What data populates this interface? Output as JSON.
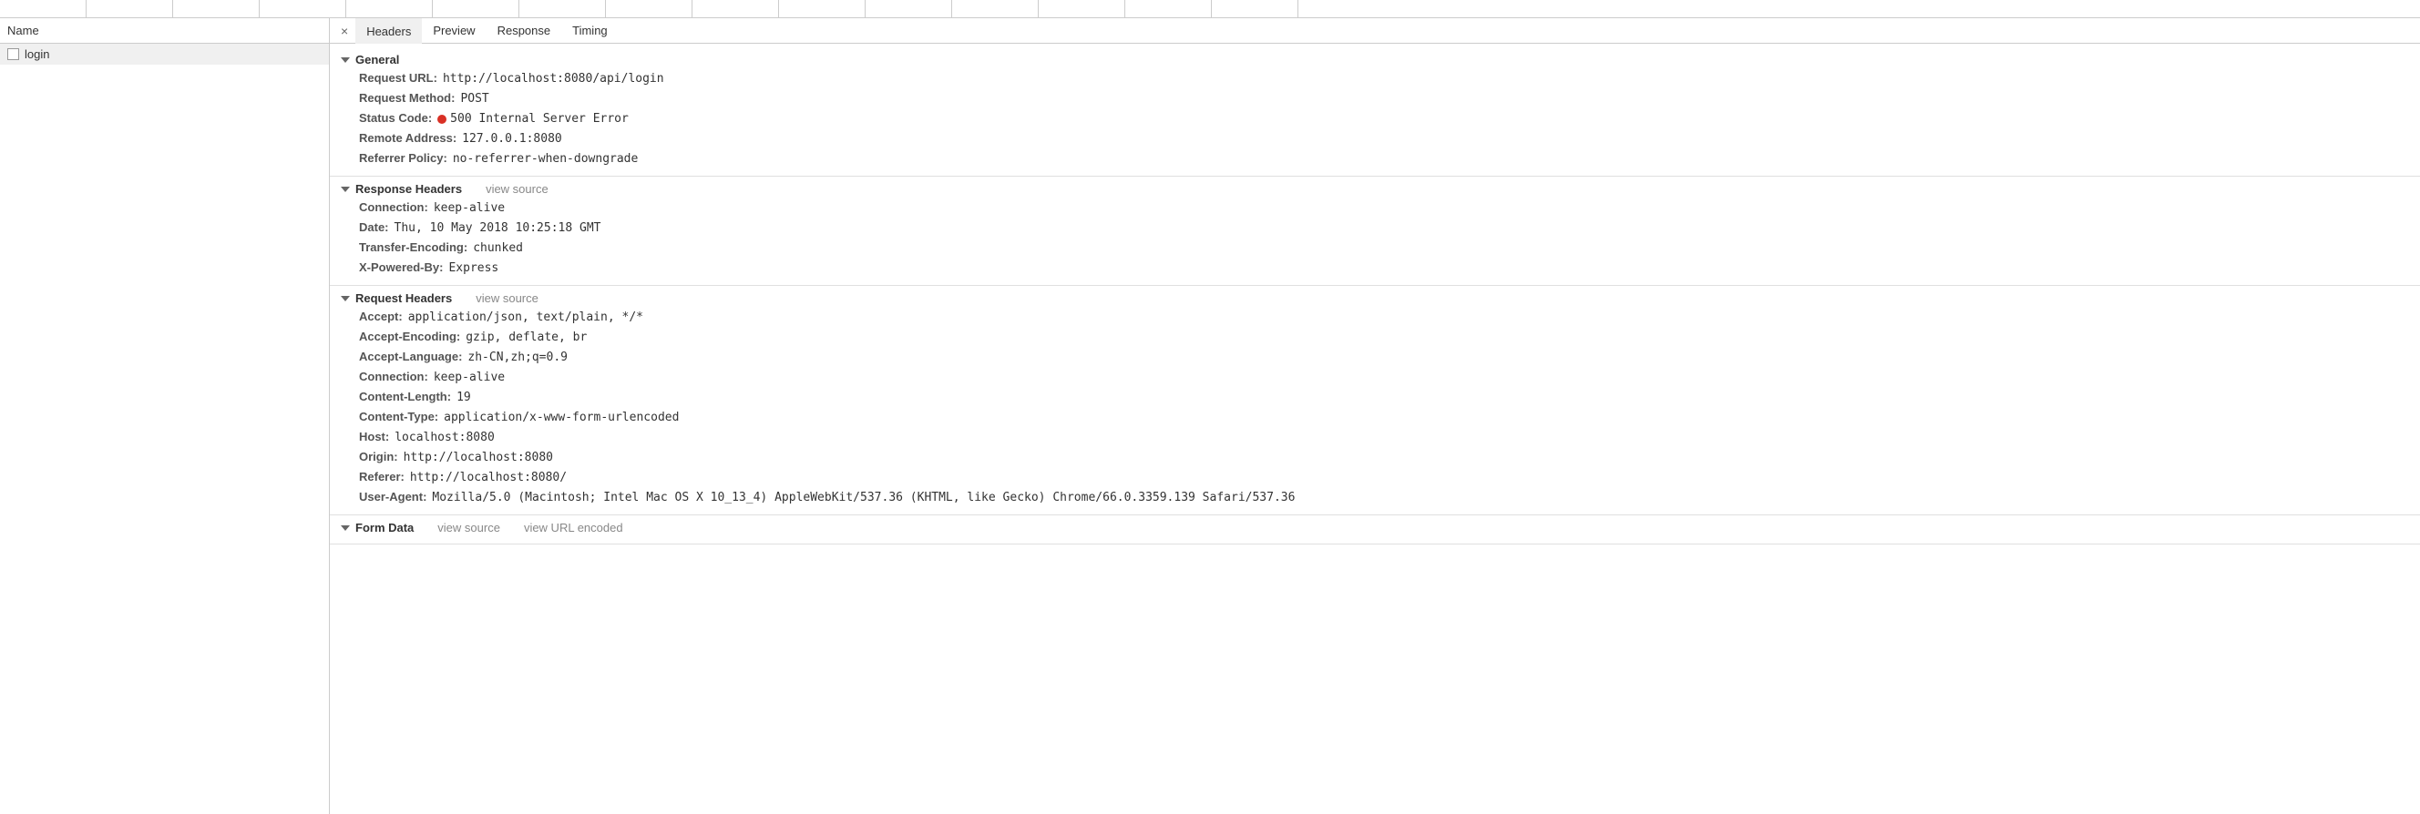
{
  "leftPanel": {
    "header": "Name",
    "requests": [
      {
        "name": "login"
      }
    ]
  },
  "detailTabs": {
    "close": "×",
    "headers": "Headers",
    "preview": "Preview",
    "response": "Response",
    "timing": "Timing"
  },
  "links": {
    "viewSource": "view source",
    "viewUrlEncoded": "view URL encoded"
  },
  "sections": {
    "general": {
      "title": "General",
      "requestUrlLabel": "Request URL:",
      "requestUrlValue": "http://localhost:8080/api/login",
      "requestMethodLabel": "Request Method:",
      "requestMethodValue": "POST",
      "statusCodeLabel": "Status Code:",
      "statusCodeValue": "500 Internal Server Error",
      "remoteAddressLabel": "Remote Address:",
      "remoteAddressValue": "127.0.0.1:8080",
      "referrerPolicyLabel": "Referrer Policy:",
      "referrerPolicyValue": "no-referrer-when-downgrade"
    },
    "responseHeaders": {
      "title": "Response Headers",
      "connectionLabel": "Connection:",
      "connectionValue": "keep-alive",
      "dateLabel": "Date:",
      "dateValue": "Thu, 10 May 2018 10:25:18 GMT",
      "transferEncodingLabel": "Transfer-Encoding:",
      "transferEncodingValue": "chunked",
      "xPoweredByLabel": "X-Powered-By:",
      "xPoweredByValue": "Express"
    },
    "requestHeaders": {
      "title": "Request Headers",
      "acceptLabel": "Accept:",
      "acceptValue": "application/json, text/plain, */*",
      "acceptEncodingLabel": "Accept-Encoding:",
      "acceptEncodingValue": "gzip, deflate, br",
      "acceptLanguageLabel": "Accept-Language:",
      "acceptLanguageValue": "zh-CN,zh;q=0.9",
      "connectionLabel": "Connection:",
      "connectionValue": "keep-alive",
      "contentLengthLabel": "Content-Length:",
      "contentLengthValue": "19",
      "contentTypeLabel": "Content-Type:",
      "contentTypeValue": "application/x-www-form-urlencoded",
      "hostLabel": "Host:",
      "hostValue": "localhost:8080",
      "originLabel": "Origin:",
      "originValue": "http://localhost:8080",
      "refererLabel": "Referer:",
      "refererValue": "http://localhost:8080/",
      "userAgentLabel": "User-Agent:",
      "userAgentValue": "Mozilla/5.0 (Macintosh; Intel Mac OS X 10_13_4) AppleWebKit/537.36 (KHTML, like Gecko) Chrome/66.0.3359.139 Safari/537.36"
    },
    "formData": {
      "title": "Form Data"
    }
  }
}
